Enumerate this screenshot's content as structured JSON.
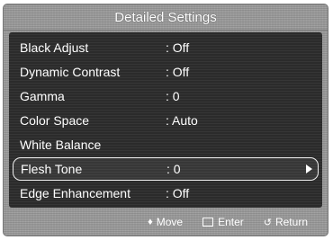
{
  "window": {
    "title": "Detailed Settings"
  },
  "menu": {
    "rows": [
      {
        "label": "Black Adjust",
        "value": ": Off"
      },
      {
        "label": "Dynamic Contrast",
        "value": ": Off"
      },
      {
        "label": "Gamma",
        "value": ": 0"
      },
      {
        "label": "Color Space",
        "value": ": Auto"
      },
      {
        "label": "White Balance",
        "value": ""
      },
      {
        "label": "Flesh Tone",
        "value": ": 0",
        "selected": true
      },
      {
        "label": "Edge Enhancement",
        "value": ": Off"
      }
    ]
  },
  "footer": {
    "move_icon": "updown-icon",
    "move_label": "Move",
    "enter_icon": "enter-icon",
    "enter_label": "Enter",
    "return_icon": "return-icon",
    "return_label": "Return"
  }
}
